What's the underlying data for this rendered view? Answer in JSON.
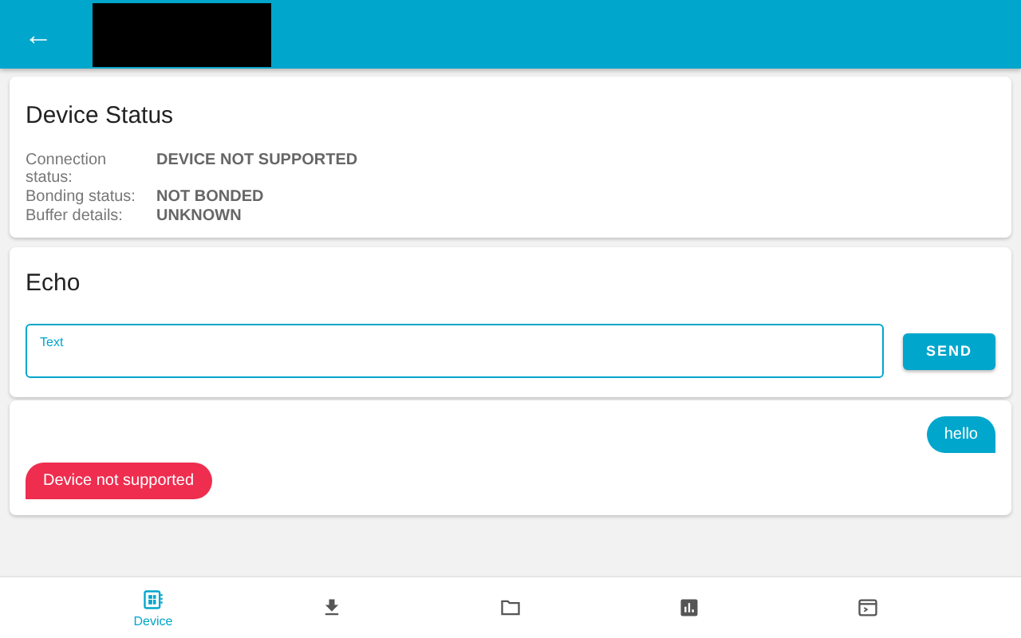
{
  "app_bar": {
    "back_icon": "←",
    "title_redacted": true
  },
  "device_status": {
    "title": "Device Status",
    "rows": [
      {
        "label": "Connection status:",
        "value": "DEVICE NOT SUPPORTED"
      },
      {
        "label": "Bonding status:",
        "value": "NOT BONDED"
      },
      {
        "label": "Buffer details:",
        "value": "UNKNOWN"
      }
    ]
  },
  "echo": {
    "title": "Echo",
    "field": {
      "label": "Text"
    },
    "send_button": "SEND"
  },
  "messages": [
    {
      "kind": "sent",
      "text": "hello"
    },
    {
      "kind": "error",
      "text": "Device not supported"
    }
  ],
  "bottom_nav": [
    {
      "kind": "device",
      "label": "Device",
      "selected": true
    },
    {
      "kind": "download",
      "selected": false
    },
    {
      "kind": "folder",
      "selected": false
    },
    {
      "kind": "chart",
      "selected": false
    },
    {
      "kind": "terminal",
      "selected": false
    }
  ]
}
